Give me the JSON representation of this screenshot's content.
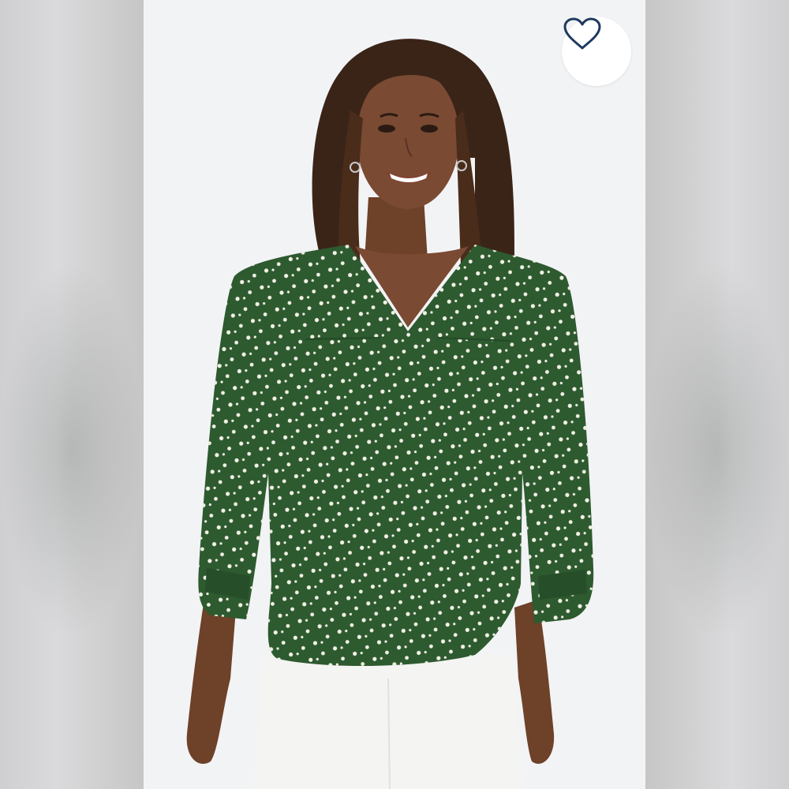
{
  "listing": {
    "favorite_icon": "heart-outline-icon",
    "colors": {
      "backdrop": "#f2f3f5",
      "garment": "#2d5a2f",
      "dots": "#f3f1e6",
      "pants": "#f4f4f2",
      "skin": "#7a4a33",
      "hair": "#3a2418",
      "heart_stroke": "#1f3a5f"
    }
  }
}
